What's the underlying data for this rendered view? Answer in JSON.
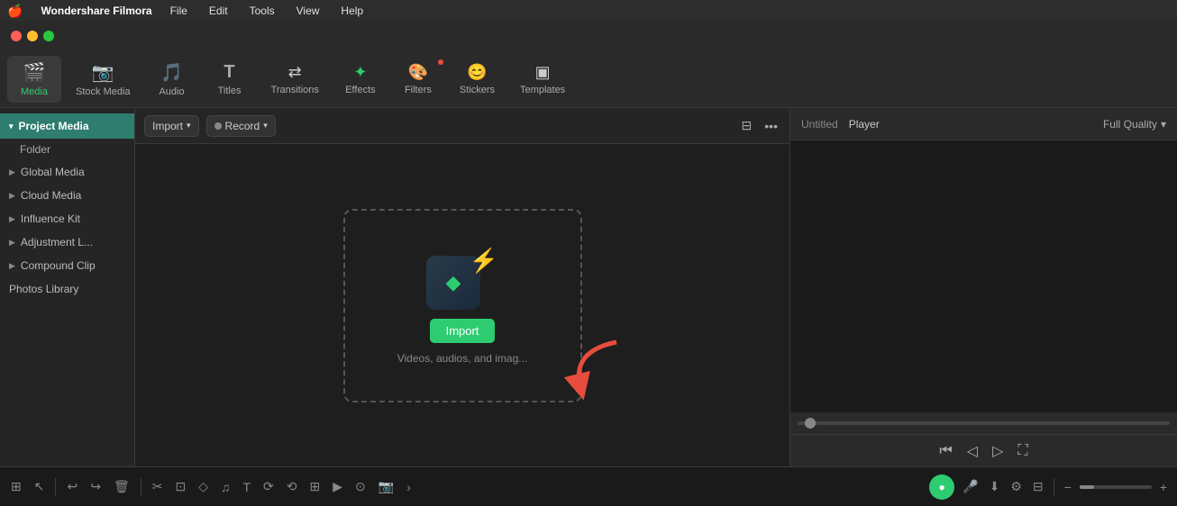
{
  "menubar": {
    "apple": "🍎",
    "app_name": "Wondershare Filmora",
    "items": [
      "File",
      "Edit",
      "Tools",
      "View",
      "Help"
    ]
  },
  "toolbar": {
    "items": [
      {
        "id": "media",
        "icon": "🎬",
        "label": "Media",
        "active": true
      },
      {
        "id": "stock-media",
        "icon": "📷",
        "label": "Stock Media",
        "active": false
      },
      {
        "id": "audio",
        "icon": "🎵",
        "label": "Audio",
        "active": false
      },
      {
        "id": "titles",
        "icon": "T",
        "label": "Titles",
        "active": false
      },
      {
        "id": "transitions",
        "icon": "⇄",
        "label": "Transitions",
        "active": false
      },
      {
        "id": "effects",
        "icon": "✦",
        "label": "Effects",
        "active": false
      },
      {
        "id": "filters",
        "icon": "⊙",
        "label": "Filters",
        "active": false,
        "badge": true
      },
      {
        "id": "stickers",
        "icon": "❋",
        "label": "Stickers",
        "active": false
      },
      {
        "id": "templates",
        "icon": "▣",
        "label": "Templates",
        "active": false
      }
    ]
  },
  "sidebar": {
    "items": [
      {
        "id": "project-media",
        "label": "Project Media",
        "active": true,
        "arrow": "▾"
      },
      {
        "id": "folder",
        "label": "Folder",
        "indent": true
      },
      {
        "id": "global-media",
        "label": "Global Media",
        "arrow": "▶"
      },
      {
        "id": "cloud-media",
        "label": "Cloud Media",
        "arrow": "▶"
      },
      {
        "id": "influence-kit",
        "label": "Influence Kit",
        "arrow": "▶"
      },
      {
        "id": "adjustment-l",
        "label": "Adjustment L...",
        "arrow": "▶"
      },
      {
        "id": "compound-clip",
        "label": "Compound Clip",
        "arrow": "▶"
      },
      {
        "id": "photos-library",
        "label": "Photos Library"
      }
    ]
  },
  "media_toolbar": {
    "import_label": "Import",
    "record_label": "Record",
    "filter_icon": "⊟",
    "more_icon": "•••"
  },
  "drop_zone": {
    "import_button": "Import",
    "drop_text": "Videos, audios, and imag...",
    "logo_arrow": "⚡",
    "logo_bolt": "◆"
  },
  "preview": {
    "title": "Untitled",
    "player_label": "Player",
    "quality_label": "Full Quality",
    "quality_arrow": "▾"
  },
  "timeline": {
    "buttons": [
      "⊞",
      "↩",
      "↪",
      "🗑",
      "✂",
      "⊡",
      "◇",
      "♪",
      "T",
      "⟳",
      "⟲",
      "⊞",
      "►",
      "⊙",
      "⊚"
    ],
    "more_label": "›",
    "zoom_minus": "−",
    "zoom_bar": "━━━━━━━━━━━━━━━"
  }
}
